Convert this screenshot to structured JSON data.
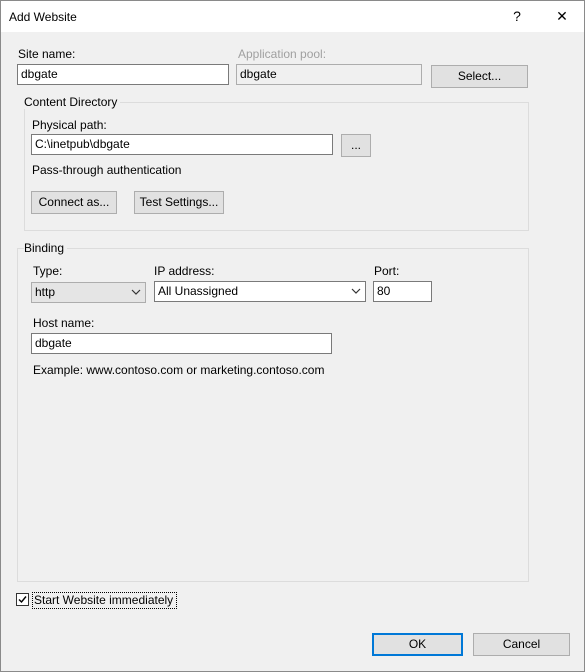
{
  "window": {
    "title": "Add Website",
    "help_glyph": "?",
    "close_glyph": "✕"
  },
  "site": {
    "site_name_label": "Site name:",
    "site_name_value": "dbgate",
    "app_pool_label": "Application pool:",
    "app_pool_value": "dbgate",
    "select_button": "Select..."
  },
  "content_directory": {
    "legend": "Content Directory",
    "physical_path_label": "Physical path:",
    "physical_path_value": "C:\\inetpub\\dbgate",
    "browse_button": "...",
    "passthrough_label": "Pass-through authentication",
    "connect_as_button": "Connect as...",
    "test_settings_button": "Test Settings..."
  },
  "binding": {
    "legend": "Binding",
    "type_label": "Type:",
    "type_value": "http",
    "ip_label": "IP address:",
    "ip_value": "All Unassigned",
    "port_label": "Port:",
    "port_value": "80",
    "host_name_label": "Host name:",
    "host_name_value": "dbgate",
    "example_text": "Example: www.contoso.com or marketing.contoso.com"
  },
  "start_website": {
    "label": "Start Website immediately",
    "checked": true
  },
  "footer": {
    "ok_button": "OK",
    "cancel_button": "Cancel"
  },
  "colors": {
    "accent": "#0078d7",
    "dialog_bg": "#f0f0f0",
    "titlebar_bg": "#ffffff"
  }
}
